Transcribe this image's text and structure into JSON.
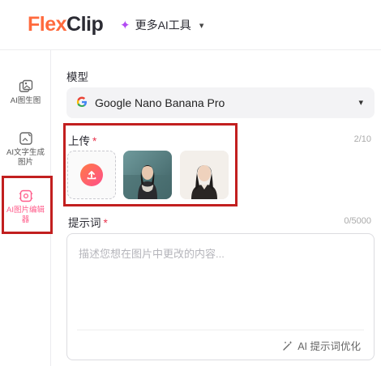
{
  "header": {
    "logo_part1": "Flex",
    "logo_part2": "Clip",
    "ai_tools_label": "更多AI工具",
    "sparkle_icon": "sparkle-icon",
    "chevron": "▾"
  },
  "sidebar": {
    "items": [
      {
        "label": "AI图生图",
        "icon": "image-to-image-icon",
        "active": false
      },
      {
        "label": "AI文字生成图片",
        "icon": "text-to-image-icon",
        "active": false
      },
      {
        "label": "AI图片编辑器",
        "icon": "image-editor-icon",
        "active": true
      }
    ],
    "active_color": "#ff5d8b"
  },
  "main": {
    "model": {
      "label": "模型",
      "selected": "Google Nano Banana Pro",
      "icon": "google-icon",
      "chevron": "▾"
    },
    "upload": {
      "label": "上传",
      "required_mark": "*",
      "counter": "2/10",
      "upload_icon": "upload-icon",
      "images": [
        "portrait-woman-scarf-outdoor",
        "portrait-woman-indoor"
      ]
    },
    "prompt": {
      "label": "提示词",
      "required_mark": "*",
      "counter": "0/5000",
      "placeholder": "描述您想在图片中更改的内容...",
      "optimize_label": "AI 提示词优化",
      "optimize_icon": "magic-wand-icon"
    }
  },
  "colors": {
    "brand_orange": "#ff6a3d",
    "brand_pink": "#ff4f8b",
    "required_red": "#e8344e",
    "highlight_red": "#c21f1f"
  }
}
